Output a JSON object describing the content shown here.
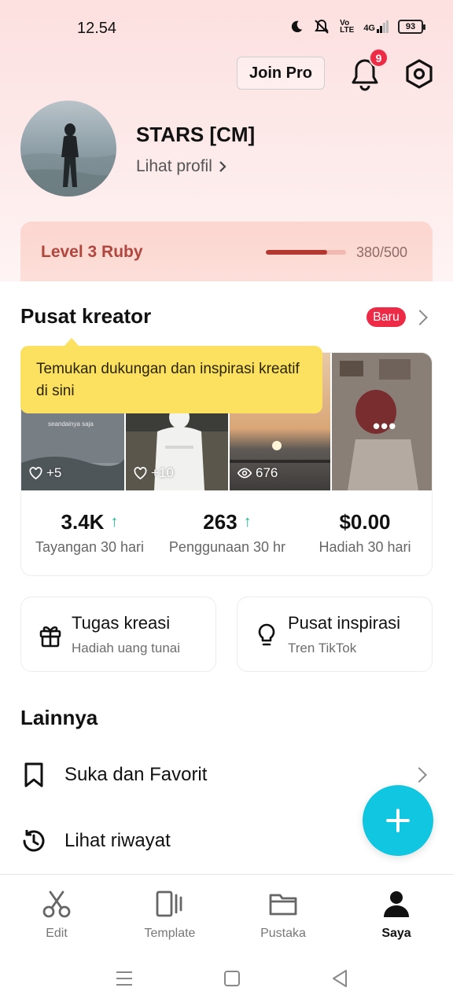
{
  "status_bar": {
    "time": "12.54",
    "network": "4G",
    "battery": "93"
  },
  "header": {
    "join_pro_label": "Join Pro",
    "notification_count": "9"
  },
  "profile": {
    "username": "STARS [CM]",
    "view_profile_label": "Lihat profil"
  },
  "level": {
    "label": "Level 3 Ruby",
    "progress_current": 380,
    "progress_max": 500,
    "progress_text": "380/500"
  },
  "creator_center": {
    "title": "Pusat kreator",
    "badge": "Baru",
    "tooltip": "Temukan dukungan dan inspirasi kreatif di sini",
    "thumbnails": [
      {
        "stat_icon": "heart-icon",
        "stat": "+5",
        "caption": "seandainya saja"
      },
      {
        "stat_icon": "heart-icon",
        "stat": "+10"
      },
      {
        "stat_icon": "eye-icon",
        "stat": "676"
      },
      {
        "stat_icon": "more-icon",
        "stat": "•••"
      }
    ],
    "stats": [
      {
        "value": "3.4K",
        "trend": "up",
        "label": "Tayangan 30 hari"
      },
      {
        "value": "263",
        "trend": "up",
        "label": "Penggunaan 30 hr"
      },
      {
        "value": "$0.00",
        "label": "Hadiah 30 hari"
      }
    ]
  },
  "quick_cards": [
    {
      "icon": "gift-icon",
      "title": "Tugas kreasi",
      "subtitle": "Hadiah uang tunai"
    },
    {
      "icon": "lightbulb-icon",
      "title": "Pusat inspirasi",
      "subtitle": "Tren TikTok"
    }
  ],
  "more": {
    "title": "Lainnya",
    "items": [
      {
        "icon": "bookmark-icon",
        "label": "Suka dan Favorit"
      },
      {
        "icon": "history-icon",
        "label": "Lihat riwayat"
      }
    ]
  },
  "tabs": [
    {
      "icon": "scissors-icon",
      "label": "Edit",
      "active": false
    },
    {
      "icon": "template-icon",
      "label": "Template",
      "active": false
    },
    {
      "icon": "folder-icon",
      "label": "Pustaka",
      "active": false
    },
    {
      "icon": "person-icon",
      "label": "Saya",
      "active": true
    }
  ],
  "colors": {
    "accent": "#10c6e0",
    "badge": "#ee2b47",
    "level": "#b0463d",
    "trend_up": "#1bb88e",
    "tooltip": "#fce160"
  }
}
